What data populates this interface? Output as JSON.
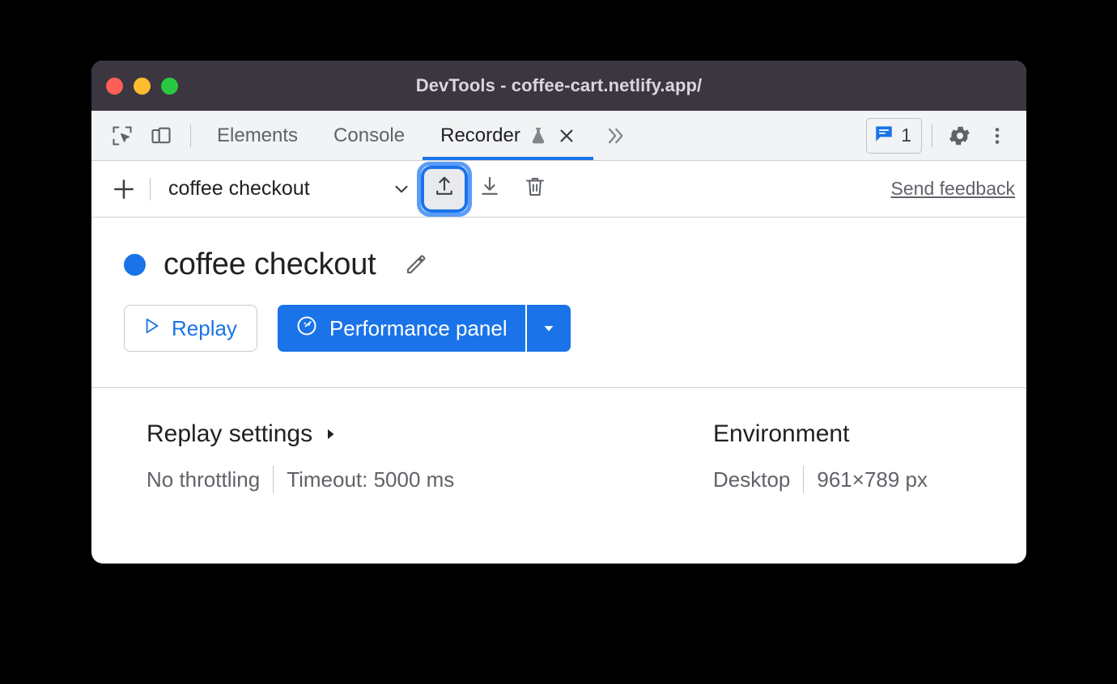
{
  "window": {
    "title": "DevTools - coffee-cart.netlify.app/",
    "traffic_lights": [
      "close",
      "minimize",
      "maximize"
    ],
    "colors": {
      "titlebar_bg": "#3b3640",
      "close": "#ff5f56",
      "minimize": "#febc2e",
      "maximize": "#28c840",
      "accent_blue": "#1a73e8",
      "focus_ring": "#5a9cf8"
    }
  },
  "tabbar": {
    "inspect_icon": "inspect-element-icon",
    "device_icon": "device-toolbar-icon",
    "tabs": [
      {
        "label": "Elements",
        "active": false
      },
      {
        "label": "Console",
        "active": false
      },
      {
        "label": "Recorder",
        "active": true,
        "experimental": true,
        "closable": true
      }
    ],
    "more_tabs_icon": "chevron-double-right-icon",
    "issues": {
      "icon": "issues-message-icon",
      "count": "1"
    },
    "settings_icon": "gear-icon",
    "menu_icon": "three-dots-vertical-icon"
  },
  "recorder_toolbar": {
    "add_label": "add-recording",
    "selected_recording": "coffee checkout",
    "dropdown_icon": "chevron-down-icon",
    "actions": [
      {
        "name": "export-recording",
        "icon": "upload-icon",
        "focused": true
      },
      {
        "name": "import-recording",
        "icon": "download-icon",
        "focused": false
      },
      {
        "name": "delete-recording",
        "icon": "trash-icon",
        "focused": false
      }
    ],
    "feedback_link": "Send feedback"
  },
  "recording": {
    "status_dot_color": "#1a73e8",
    "title": "coffee checkout",
    "edit_icon": "pencil-icon",
    "replay_button": {
      "label": "Replay",
      "icon": "play-triangle-icon"
    },
    "performance_button": {
      "label": "Performance panel",
      "icon": "performance-gauge-icon",
      "caret_icon": "chevron-down-icon"
    }
  },
  "settings": {
    "replay": {
      "heading": "Replay settings",
      "caret_icon": "caret-right-icon",
      "throttling": "No throttling",
      "timeout": "Timeout: 5000 ms"
    },
    "environment": {
      "heading": "Environment",
      "device": "Desktop",
      "viewport": "961×789 px"
    }
  }
}
